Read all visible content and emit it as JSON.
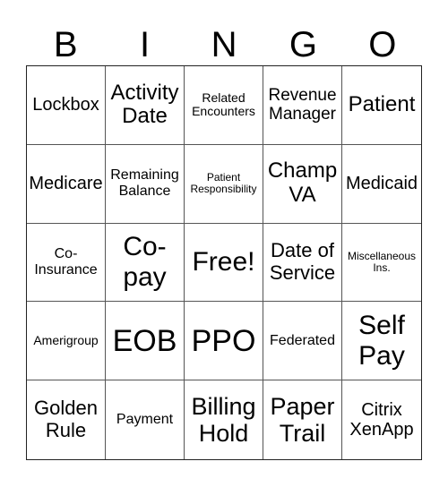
{
  "header": {
    "letters": [
      "B",
      "I",
      "N",
      "G",
      "O"
    ]
  },
  "board": {
    "cells": [
      "Lockbox",
      "Activity Date",
      "Related Encounters",
      "Revenue Manager",
      "Patient",
      "Medicare",
      "Remaining Balance",
      "Patient Responsibility",
      "Champ VA",
      "Medicaid",
      "Co-Insurance",
      "Co-pay",
      "Free!",
      "Date of Service",
      "Miscellaneous Ins.",
      "Amerigroup",
      "EOB",
      "PPO",
      "Federated",
      "Self Pay",
      "Golden Rule",
      "Payment",
      "Billing Hold",
      "Paper Trail",
      "Citrix XenApp"
    ],
    "free_space_label": "Free!"
  }
}
